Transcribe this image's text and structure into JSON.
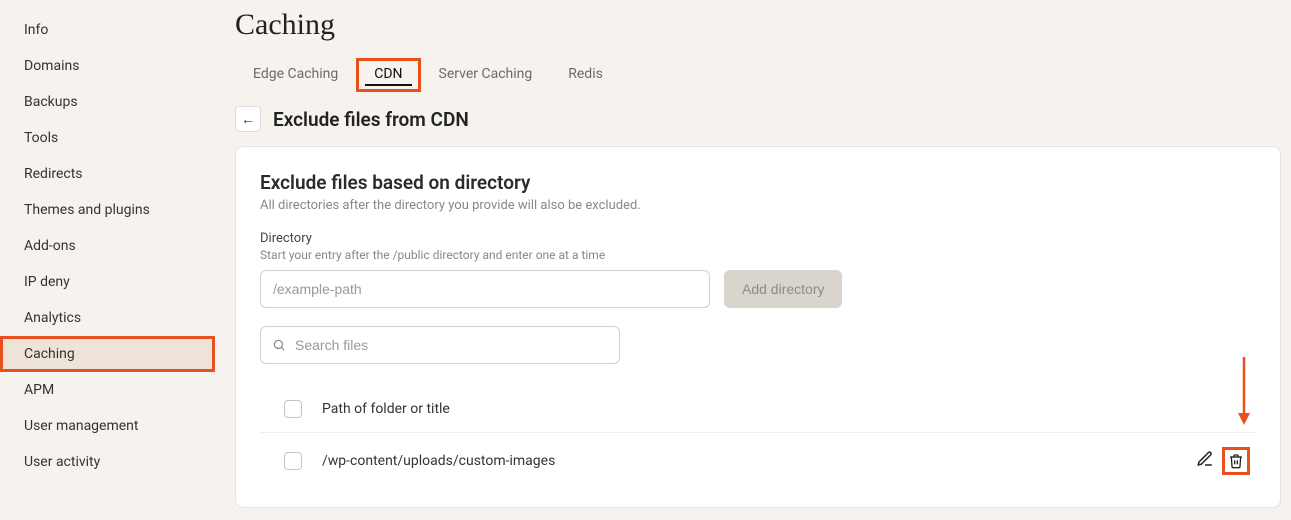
{
  "sidebar": {
    "items": [
      {
        "label": "Info"
      },
      {
        "label": "Domains"
      },
      {
        "label": "Backups"
      },
      {
        "label": "Tools"
      },
      {
        "label": "Redirects"
      },
      {
        "label": "Themes and plugins"
      },
      {
        "label": "Add-ons"
      },
      {
        "label": "IP deny"
      },
      {
        "label": "Analytics"
      },
      {
        "label": "Caching"
      },
      {
        "label": "APM"
      },
      {
        "label": "User management"
      },
      {
        "label": "User activity"
      }
    ],
    "active_index": 9
  },
  "page": {
    "title": "Caching",
    "subheader_title": "Exclude files from CDN"
  },
  "tabs": {
    "items": [
      {
        "label": "Edge Caching"
      },
      {
        "label": "CDN"
      },
      {
        "label": "Server Caching"
      },
      {
        "label": "Redis"
      }
    ],
    "active_index": 1
  },
  "section": {
    "title": "Exclude files based on directory",
    "desc": "All directories after the directory you provide will also be excluded.",
    "field_label": "Directory",
    "field_hint": "Start your entry after the /public directory and enter one at a time",
    "input_placeholder": "/example-path",
    "add_button": "Add directory",
    "search_placeholder": "Search files",
    "list_header": "Path of folder or title",
    "rows": [
      {
        "path": "/wp-content/uploads/custom-images"
      }
    ]
  }
}
